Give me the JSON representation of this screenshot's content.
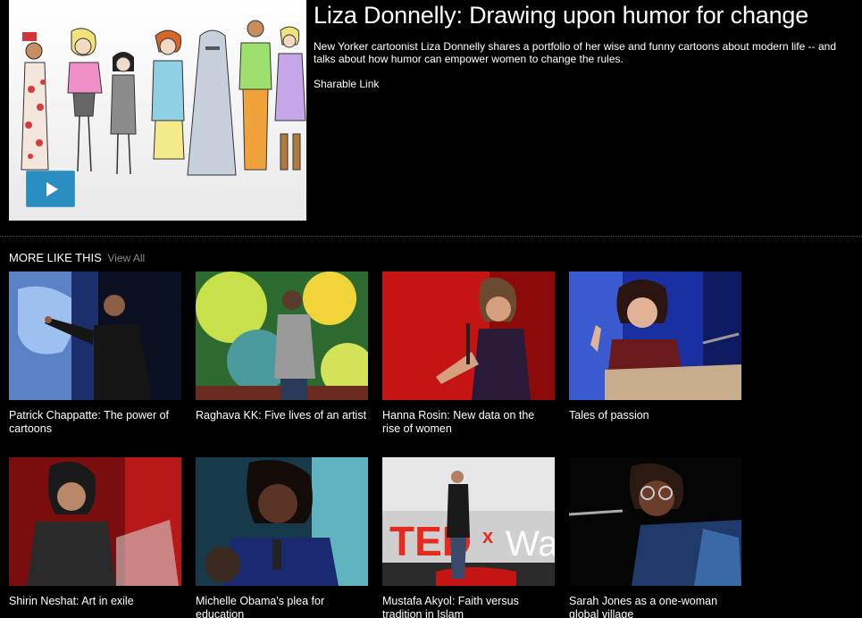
{
  "talk": {
    "title": "Liza Donnelly: Drawing upon humor for change",
    "description": "New Yorker cartoonist Liza Donnelly shares a portfolio of her wise and funny cartoons about modern life -- and talks about how humor can empower women to change the rules.",
    "share_label": "Sharable Link"
  },
  "more": {
    "heading": "MORE LIKE THIS",
    "view_all": "View All",
    "items": [
      {
        "title": "Patrick Chappatte: The power of cartoons"
      },
      {
        "title": "Raghava KK: Five lives of an artist"
      },
      {
        "title": "Hanna Rosin: New data on the rise of women"
      },
      {
        "title": "Tales of passion"
      },
      {
        "title": "Shirin Neshat: Art in exile"
      },
      {
        "title": "Michelle Obama's plea for education"
      },
      {
        "title": "Mustafa Akyol: Faith versus tradition in Islam"
      },
      {
        "title": "Sarah Jones as a one-woman global village"
      }
    ]
  },
  "colors": {
    "background": "#000000",
    "play_button": "#2a8fc0",
    "view_all": "#8a8a8a",
    "ted_red": "#e62b1e"
  }
}
